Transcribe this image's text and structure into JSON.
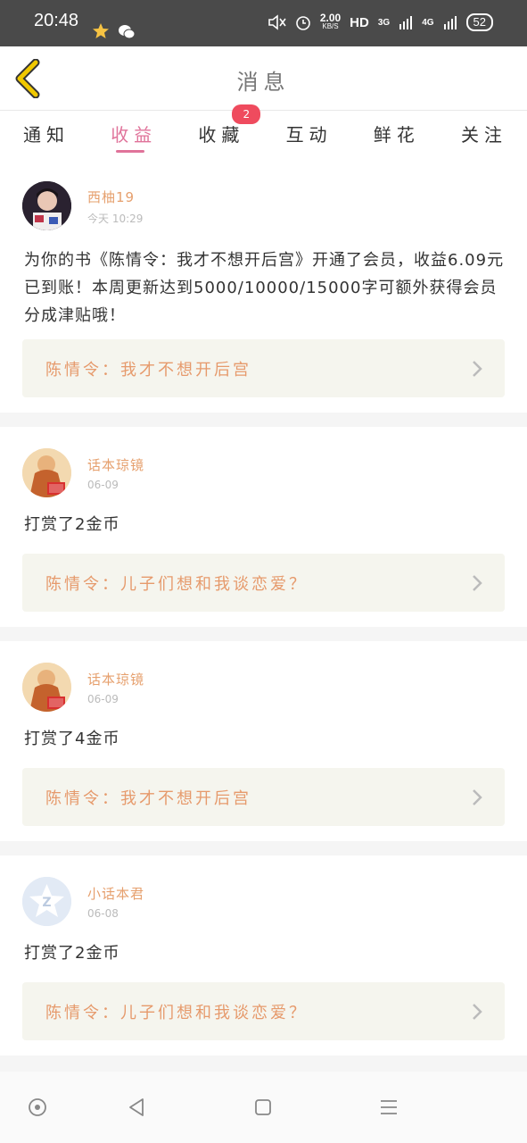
{
  "status_bar": {
    "time": "20:48",
    "net_speed": "2.00",
    "net_speed_unit": "KB/S",
    "hd": "HD",
    "network_1": "3G",
    "network_2": "4G",
    "battery": "52"
  },
  "header": {
    "title": "消息"
  },
  "tabs": [
    {
      "label": "通知"
    },
    {
      "label": "收益"
    },
    {
      "label": "收藏",
      "badge": "2"
    },
    {
      "label": "互动"
    },
    {
      "label": "鲜花"
    },
    {
      "label": "关注"
    }
  ],
  "messages": [
    {
      "name": "西柚19",
      "time": "今天 10:29",
      "body": "为你的书《陈情令：我才不想开后宫》开通了会员，收益6.09元已到账！本周更新达到5000/10000/15000字可额外获得会员分成津贴哦！",
      "link": "陈情令：我才不想开后宫"
    },
    {
      "name": "话本琼镜",
      "time": "06-09",
      "body": "打赏了2金币",
      "link": "陈情令：儿子们想和我谈恋爱？"
    },
    {
      "name": "话本琼镜",
      "time": "06-09",
      "body": "打赏了4金币",
      "link": "陈情令：我才不想开后宫"
    },
    {
      "name": "小话本君",
      "time": "06-08",
      "body": "打赏了2金币",
      "link": "陈情令：儿子们想和我谈恋爱？"
    }
  ],
  "colors": {
    "accent": "#e0739a",
    "name": "#e6a06e",
    "badge": "#ef4b5e",
    "back_arrow": "#f0c800"
  }
}
